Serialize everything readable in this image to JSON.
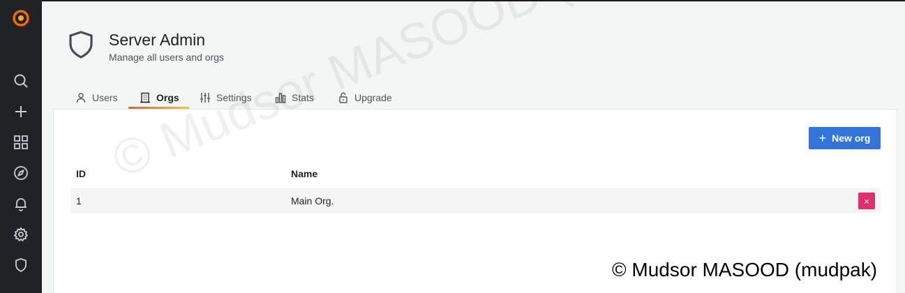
{
  "sidebar": {
    "items": [
      {
        "name": "grafana-logo",
        "icon": "grafana-logo"
      },
      {
        "name": "search",
        "icon": "search-icon"
      },
      {
        "name": "create",
        "icon": "plus-icon"
      },
      {
        "name": "dashboards",
        "icon": "apps-icon"
      },
      {
        "name": "explore",
        "icon": "compass-icon"
      },
      {
        "name": "alerting",
        "icon": "bell-icon"
      },
      {
        "name": "configuration",
        "icon": "cog-icon"
      },
      {
        "name": "server-admin",
        "icon": "shield-icon"
      }
    ]
  },
  "header": {
    "title": "Server Admin",
    "subtitle": "Manage all users and orgs",
    "icon": "shield-icon"
  },
  "tabs": [
    {
      "label": "Users",
      "icon": "user-icon",
      "active": false
    },
    {
      "label": "Orgs",
      "icon": "building-icon",
      "active": true
    },
    {
      "label": "Settings",
      "icon": "sliders-icon",
      "active": false
    },
    {
      "label": "Stats",
      "icon": "bar-chart-icon",
      "active": false
    },
    {
      "label": "Upgrade",
      "icon": "unlock-icon",
      "active": false
    }
  ],
  "actions": {
    "new_org_label": "New org"
  },
  "table": {
    "columns": [
      "ID",
      "Name"
    ],
    "rows": [
      {
        "id": "1",
        "name": "Main Org."
      }
    ],
    "delete_label": "×"
  },
  "watermark": {
    "diagonal": "© Mudsor MASOOD (mudpak)",
    "corner": "© Mudsor MASOOD (mudpak)"
  },
  "colors": {
    "sidebar_bg": "#202226",
    "primary_button": "#3274d9",
    "danger_button": "#e02f6b",
    "active_tab_gradient_start": "#f05a28",
    "active_tab_gradient_end": "#fbca0a",
    "grafana_orange": "#f46800"
  }
}
